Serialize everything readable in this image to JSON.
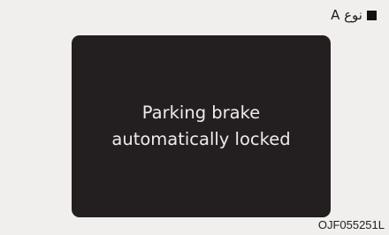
{
  "type_label": {
    "text": "نوع A",
    "bullet_icon": "filled-square-icon"
  },
  "display": {
    "line1": "Parking brake",
    "line2": "automatically locked"
  },
  "image_code": "OJF055251L"
}
